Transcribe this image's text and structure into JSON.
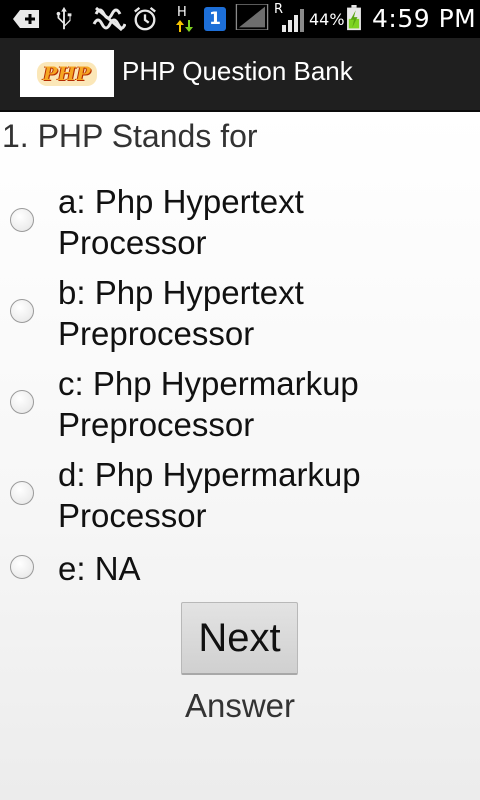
{
  "status_bar": {
    "icons": [
      "add-icon",
      "usb-icon",
      "no-signal-vibrate-icon",
      "alarm-icon",
      "hspa-data-icon",
      "sim-1-icon",
      "signal-icon",
      "roaming-signal-icon",
      "battery-charging-icon"
    ],
    "network_label": "H",
    "sim_label": "1",
    "roaming_label": "R",
    "battery_percent": "44%",
    "time": "4:59 PM"
  },
  "action_bar": {
    "logo_text": "PHP",
    "title": "PHP Question Bank"
  },
  "quiz": {
    "question": "1. PHP Stands for",
    "options": [
      {
        "label": "a: Php Hypertext Processor"
      },
      {
        "label": "b: Php Hypertext Preprocessor"
      },
      {
        "label": "c: Php Hypermarkup Preprocessor"
      },
      {
        "label": "d: Php Hypermarkup Processor"
      },
      {
        "label": "e: NA"
      }
    ],
    "next_label": "Next",
    "answer_label": "Answer"
  },
  "colors": {
    "status_bar_bg": "#000000",
    "action_bar_bg": "#1f1f1f",
    "battery_green": "#7ed321",
    "sim_badge_blue": "#1d6fd8"
  }
}
